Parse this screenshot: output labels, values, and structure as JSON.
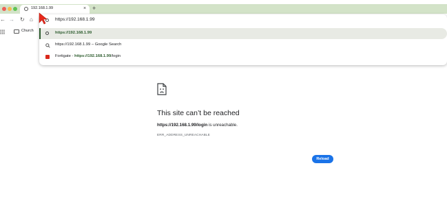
{
  "tab": {
    "title": "192.168.1.99",
    "close_glyph": "×",
    "new_tab_glyph": "+"
  },
  "toolbar": {
    "back_glyph": "←",
    "forward_glyph": "→",
    "reload_glyph": "↻",
    "home_glyph": "⌂"
  },
  "bookmarks": {
    "items": [
      {
        "label": "Church",
        "icon": "folder-icon"
      }
    ]
  },
  "omnibox": {
    "value": "https://192.168.1.99",
    "suggestions": [
      {
        "icon": "globe-icon",
        "text": "https://192.168.1.99",
        "selected": true
      },
      {
        "icon": "search-icon",
        "text": "https://192.168.1.99",
        "suffix": " – Google Search"
      },
      {
        "icon": "fortigate-icon",
        "prefix": "Fortigate - ",
        "text": "https://192.168.1.99",
        "path": "/login"
      }
    ]
  },
  "error_page": {
    "title": "This site can’t be reached",
    "url": "https://192.168.1.99/login",
    "message_suffix": " is unreachable.",
    "code": "ERR_ADDRESS_UNREACHABLE",
    "reload_label": "Reload"
  },
  "colors": {
    "tab_strip": "#d3e3c8",
    "accent_green": "#2e5d2f",
    "reload_button": "#1a73e8",
    "cursor": "#e8291c"
  }
}
